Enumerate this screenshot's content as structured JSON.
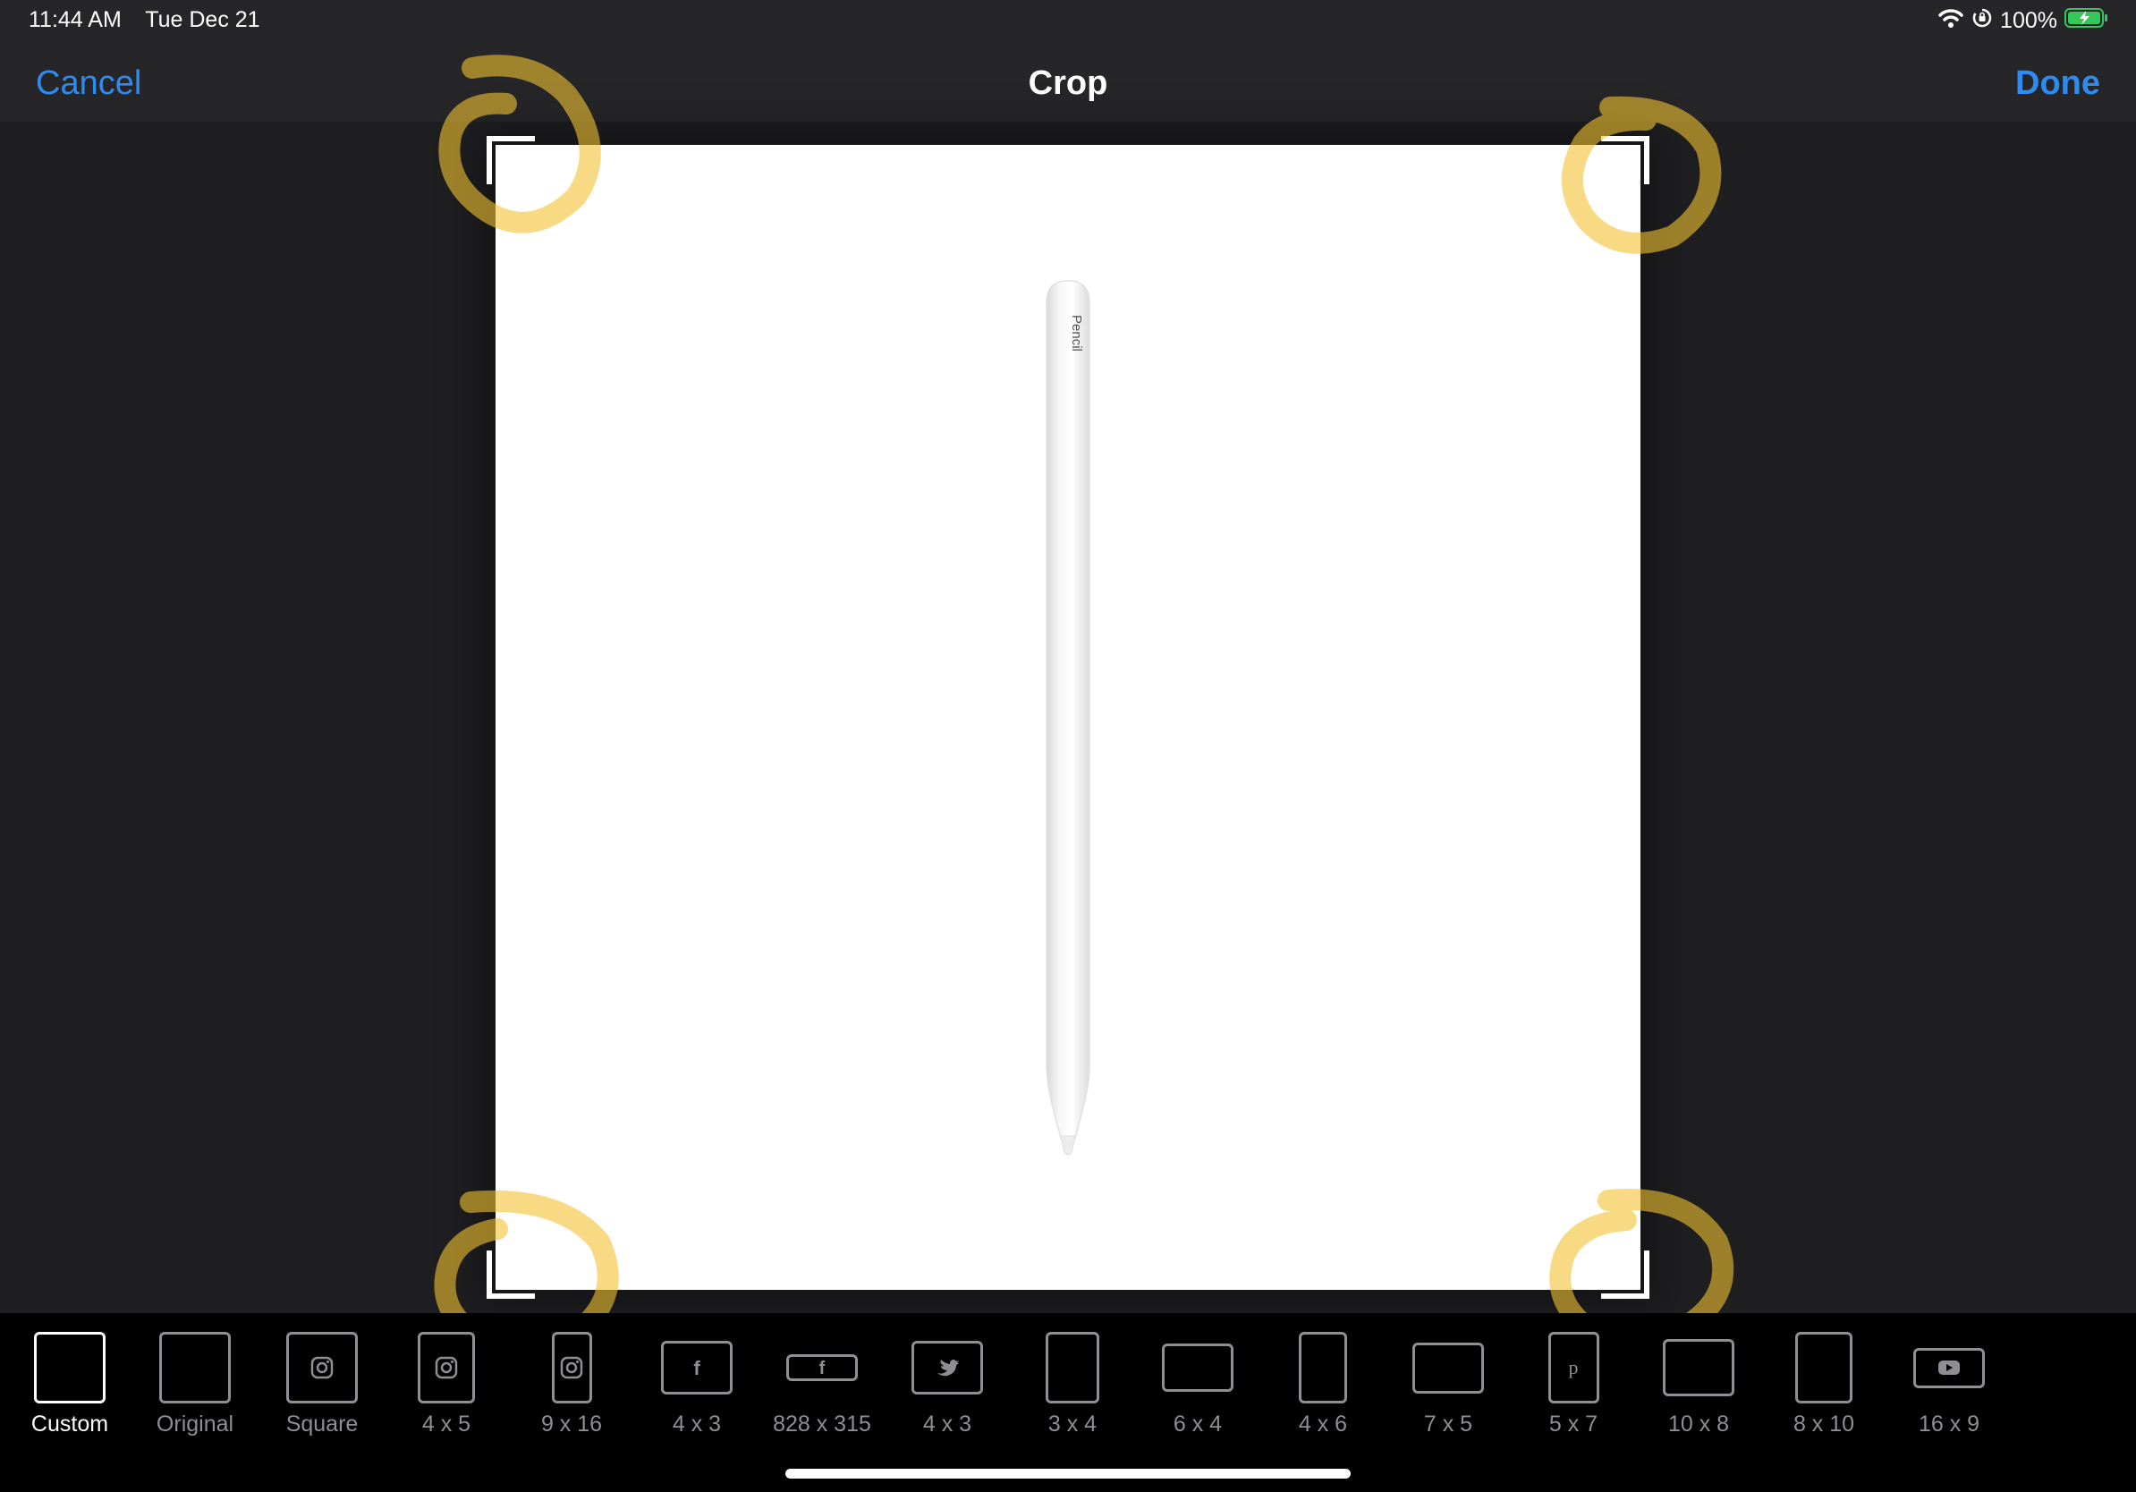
{
  "status": {
    "time": "11:44 AM",
    "date": "Tue Dec 21",
    "battery": "100%",
    "icons": [
      "wifi-icon",
      "orientation-lock-icon",
      "battery-charging-icon"
    ]
  },
  "nav": {
    "cancel": "Cancel",
    "title": "Crop",
    "done": "Done"
  },
  "photo": {
    "pencil_brand_text": "Pencil",
    "annotation_color": "#f2c230"
  },
  "colors": {
    "accent": "#2e8bf0",
    "toolbar_bg": "#000000",
    "nav_bg": "#262629",
    "canvas_bg": "#1f1f22",
    "inactive": "#8e8e93",
    "battery": "#34c759"
  },
  "aspect_options": [
    {
      "label": "Custom",
      "icon": "custom-frame-icon",
      "selected": true
    },
    {
      "label": "Original",
      "icon": "original-frame-icon"
    },
    {
      "label": "Square",
      "icon": "instagram-icon"
    },
    {
      "label": "4 x 5",
      "icon": "instagram-icon"
    },
    {
      "label": "9 x 16",
      "icon": "instagram-icon"
    },
    {
      "label": "4 x 3",
      "icon": "facebook-icon"
    },
    {
      "label": "828 x 315",
      "icon": "facebook-icon"
    },
    {
      "label": "4 x 3",
      "icon": "twitter-icon"
    },
    {
      "label": "3 x 4",
      "icon": "portrait-frame-icon"
    },
    {
      "label": "6 x 4",
      "icon": "landscape-frame-icon"
    },
    {
      "label": "4 x 6",
      "icon": "portrait-frame-icon"
    },
    {
      "label": "7 x 5",
      "icon": "landscape-frame-icon"
    },
    {
      "label": "5 x 7",
      "icon": "pinterest-icon"
    },
    {
      "label": "10 x 8",
      "icon": "landscape-frame-icon"
    },
    {
      "label": "8 x 10",
      "icon": "portrait-frame-icon"
    },
    {
      "label": "16 x 9",
      "icon": "youtube-icon"
    }
  ]
}
